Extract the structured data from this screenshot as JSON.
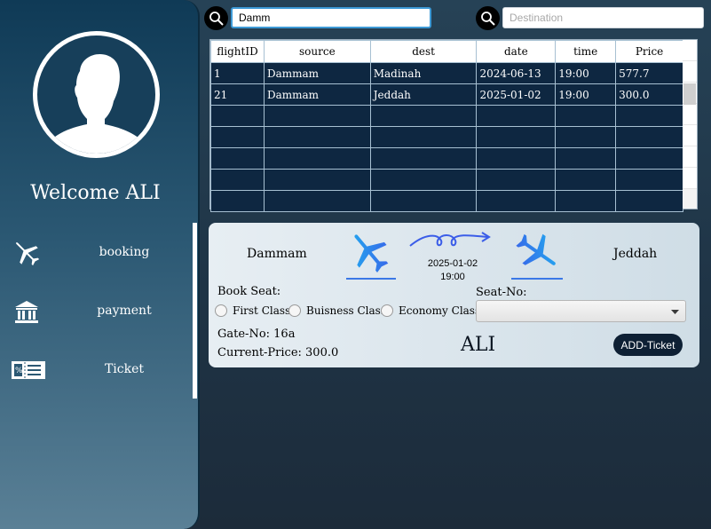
{
  "sidebar": {
    "welcome_text": "Welcome ALI",
    "items": [
      {
        "label": "booking",
        "icon": "airplane-icon"
      },
      {
        "label": "payment",
        "icon": "bank-icon"
      },
      {
        "label": "Ticket",
        "icon": "ticket-icon"
      }
    ]
  },
  "search": {
    "source_value": "Damm",
    "destination_value": "",
    "destination_placeholder": "Destination"
  },
  "table": {
    "columns": [
      "flightID",
      "source",
      "dest",
      "date",
      "time",
      "Price"
    ],
    "rows": [
      [
        "1",
        "Dammam",
        "Madinah",
        "2024-06-13",
        "19:00",
        "577.7"
      ],
      [
        "21",
        "Dammam",
        "Jeddah",
        "2025-01-02",
        "19:00",
        "300.0"
      ]
    ]
  },
  "ticket": {
    "source": "Dammam",
    "destination": "Jeddah",
    "date": "2025-01-02",
    "time": "19:00",
    "book_seat_label": "Book Seat:",
    "seat_classes": [
      "First Class",
      "Buisness Class",
      "Economy Class"
    ],
    "seat_no_label": "Seat-No:",
    "seat_no_value": "",
    "gate": "Gate-No: 16a",
    "current_price": "Current-Price: 300.0",
    "passenger_name": "ALI",
    "add_button": "ADD-Ticket"
  },
  "colors": {
    "sidebar_top": "#0f3a56",
    "table_cell_bg": "#0e2741",
    "plane_blue": "#2f7fe6",
    "button_dark": "#0e2034"
  }
}
